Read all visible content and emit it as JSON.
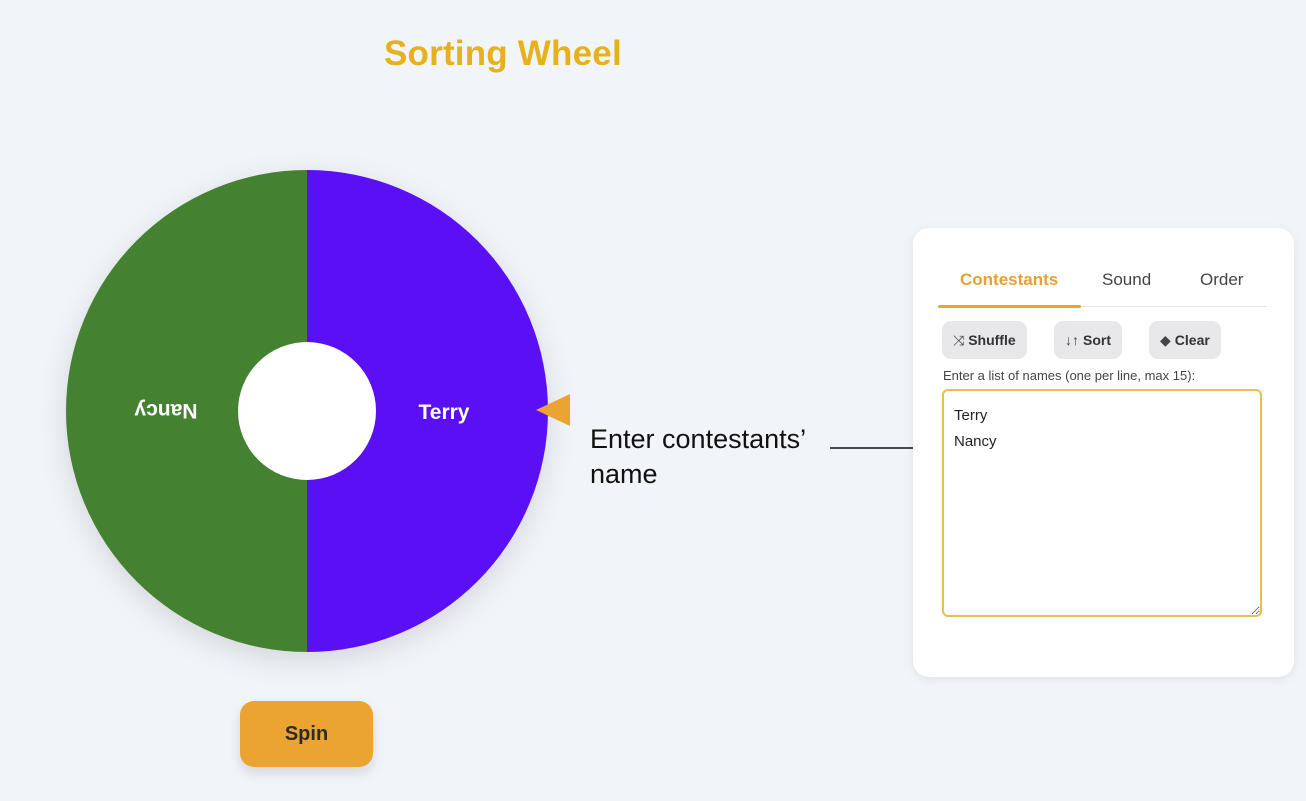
{
  "app": {
    "title": "Sorting Wheel"
  },
  "wheel": {
    "segments": [
      {
        "label": "Terry",
        "color": "#5a0ff5"
      },
      {
        "label": "Nancy",
        "color": "#448232"
      }
    ],
    "pointer_color": "#eba431",
    "hub_color": "#ffffff"
  },
  "spin": {
    "label": "Spin"
  },
  "annotation": {
    "line1": "Enter contestants’",
    "line2": "name"
  },
  "panel": {
    "tabs": [
      {
        "label": "Contestants",
        "active": true
      },
      {
        "label": "Sound",
        "active": false
      },
      {
        "label": "Order",
        "active": false
      }
    ],
    "toolbar": {
      "shuffle_icon": "⤨",
      "shuffle_label": "Shuffle",
      "sort_icon": "↓↑",
      "sort_label": "Sort",
      "clear_icon": "◆",
      "clear_label": "Clear"
    },
    "list_label": "Enter a list of names (one per line, max 15):",
    "names_value": "Terry\nNancy"
  },
  "colors": {
    "accent": "#eba431",
    "title": "#e6b11c",
    "background": "#f1f4f9"
  }
}
